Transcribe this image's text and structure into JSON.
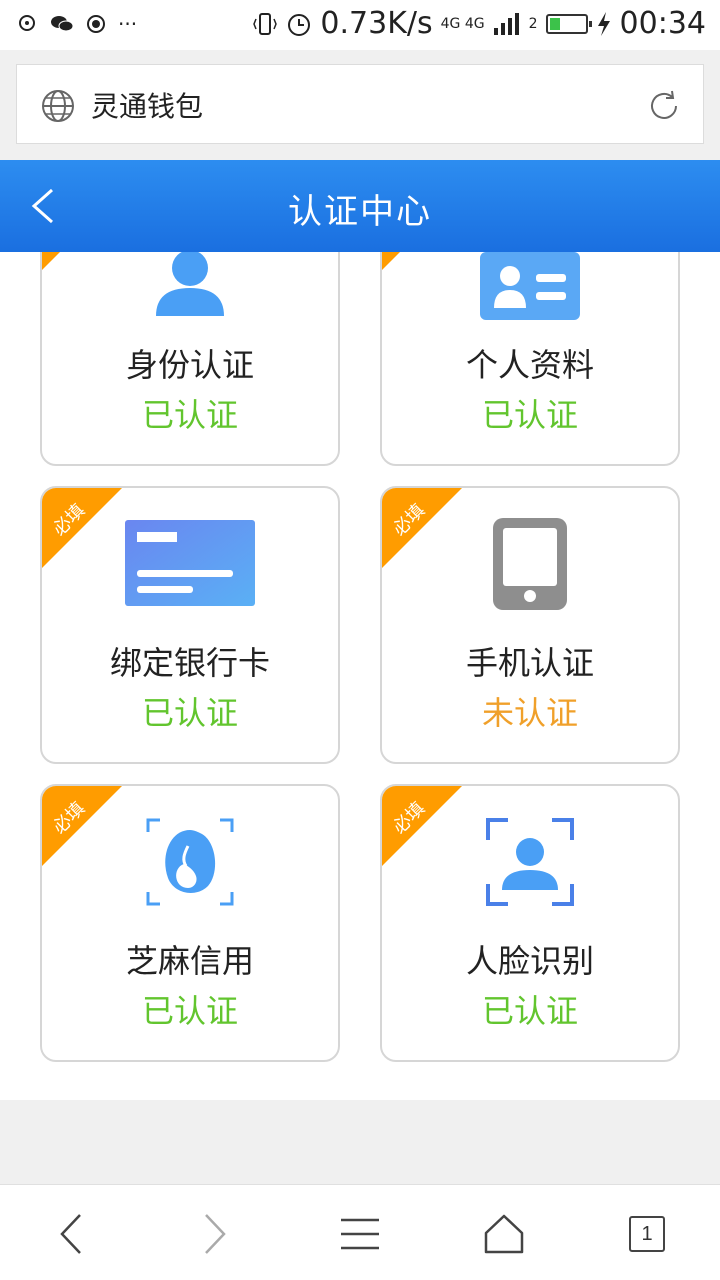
{
  "status_bar": {
    "speed": "0.73K/s",
    "network": "4G 4G",
    "signal_sub": "2",
    "time": "00:34",
    "battery_level": 0.3,
    "left_icons": [
      "notification-icon",
      "wechat-icon",
      "record-icon",
      "more-icon"
    ],
    "colors": {
      "battery": "#3cc24a"
    }
  },
  "address_bar": {
    "title": "灵通钱包",
    "icons": [
      "globe-icon",
      "refresh-icon"
    ]
  },
  "header": {
    "title": "认证中心",
    "icons": [
      "back-icon"
    ],
    "colors": {
      "start": "#2d8df0",
      "end": "#1a6fe0"
    }
  },
  "cards": [
    {
      "name": "身份认证",
      "status": "已认证",
      "required": false,
      "icon": "person-icon",
      "verified": true
    },
    {
      "name": "个人资料",
      "status": "已认证",
      "required": false,
      "icon": "id-card-icon",
      "verified": true
    },
    {
      "name": "绑定银行卡",
      "status": "已认证",
      "required": true,
      "required_label": "必填",
      "icon": "bank-card-icon",
      "verified": true
    },
    {
      "name": "手机认证",
      "status": "未认证",
      "required": true,
      "required_label": "必填",
      "icon": "phone-icon",
      "verified": false
    },
    {
      "name": "芝麻信用",
      "status": "已认证",
      "required": true,
      "required_label": "必填",
      "icon": "sesame-credit-icon",
      "verified": true
    },
    {
      "name": "人脸识别",
      "status": "已认证",
      "required": true,
      "required_label": "必填",
      "icon": "face-scan-icon",
      "verified": true
    }
  ],
  "colors": {
    "verified": "#62c52e",
    "unverified": "#f0a02a",
    "ribbon": "#ff9c00"
  },
  "bottom_nav": {
    "items": [
      "back-icon",
      "forward-icon",
      "menu-icon",
      "home-icon",
      "tabs-icon"
    ],
    "tab_count": "1"
  }
}
